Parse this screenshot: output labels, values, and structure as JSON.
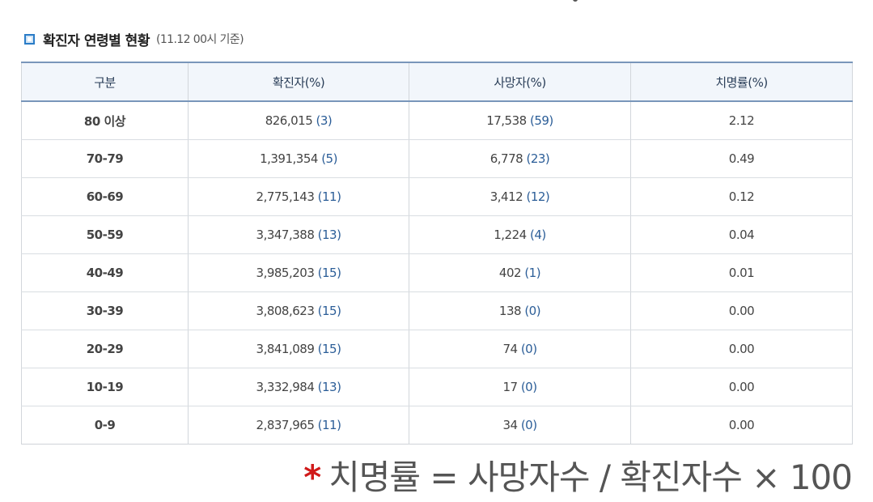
{
  "section": {
    "title": "확진자 연령별 현황",
    "subtitle": "(11.12 00시 기준)"
  },
  "table": {
    "headers": [
      "구분",
      "확진자(%)",
      "사망자(%)",
      "치명률(%)"
    ],
    "rows": [
      {
        "age": "80 이상",
        "cases": "826,015",
        "cases_pct": "(3)",
        "deaths": "17,538",
        "deaths_pct": "(59)",
        "rate": "2.12"
      },
      {
        "age": "70-79",
        "cases": "1,391,354",
        "cases_pct": "(5)",
        "deaths": "6,778",
        "deaths_pct": "(23)",
        "rate": "0.49"
      },
      {
        "age": "60-69",
        "cases": "2,775,143",
        "cases_pct": "(11)",
        "deaths": "3,412",
        "deaths_pct": "(12)",
        "rate": "0.12"
      },
      {
        "age": "50-59",
        "cases": "3,347,388",
        "cases_pct": "(13)",
        "deaths": "1,224",
        "deaths_pct": "(4)",
        "rate": "0.04"
      },
      {
        "age": "40-49",
        "cases": "3,985,203",
        "cases_pct": "(15)",
        "deaths": "402",
        "deaths_pct": "(1)",
        "rate": "0.01"
      },
      {
        "age": "30-39",
        "cases": "3,808,623",
        "cases_pct": "(15)",
        "deaths": "138",
        "deaths_pct": "(0)",
        "rate": "0.00"
      },
      {
        "age": "20-29",
        "cases": "3,841,089",
        "cases_pct": "(15)",
        "deaths": "74",
        "deaths_pct": "(0)",
        "rate": "0.00"
      },
      {
        "age": "10-19",
        "cases": "3,332,984",
        "cases_pct": "(13)",
        "deaths": "17",
        "deaths_pct": "(0)",
        "rate": "0.00"
      },
      {
        "age": "0-9",
        "cases": "2,837,965",
        "cases_pct": "(11)",
        "deaths": "34",
        "deaths_pct": "(0)",
        "rate": "0.00"
      }
    ]
  },
  "footnote": {
    "star": "*",
    "text": "치명률 = 사망자수 / 확진자수 × 100"
  },
  "colors": {
    "accent": "#2a7cc7",
    "header_bg": "#f2f6fb",
    "border": "#7996ba",
    "value_blue": "#2c5e98",
    "star_red": "#d01a1a"
  }
}
